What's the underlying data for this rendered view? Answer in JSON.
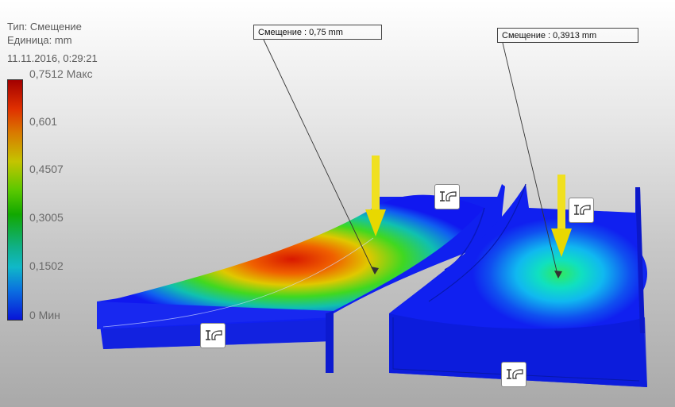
{
  "result_info": {
    "type_line": "Тип: Смещение",
    "unit_line": "Единица: mm",
    "date_line": "11.11.2016, 0:29:21"
  },
  "legend": {
    "labels": [
      "0,7512 Макс",
      "0,601",
      "0,4507",
      "0,3005",
      "0,1502",
      "0 Мин"
    ],
    "colors": [
      "#a30000",
      "#e03000",
      "#d97a00",
      "#c4c400",
      "#5ac800",
      "#11a800",
      "#10b08a",
      "#10b8c8",
      "#0a6ee0",
      "#0814d8"
    ]
  },
  "probes": [
    {
      "label": "Смещение : 0,75 mm"
    },
    {
      "label": "Смещение : 0,3913 mm"
    }
  ],
  "icons": {
    "load_arrow": "load-arrow-icon",
    "constraint": "fixed-constraint-icon"
  }
}
